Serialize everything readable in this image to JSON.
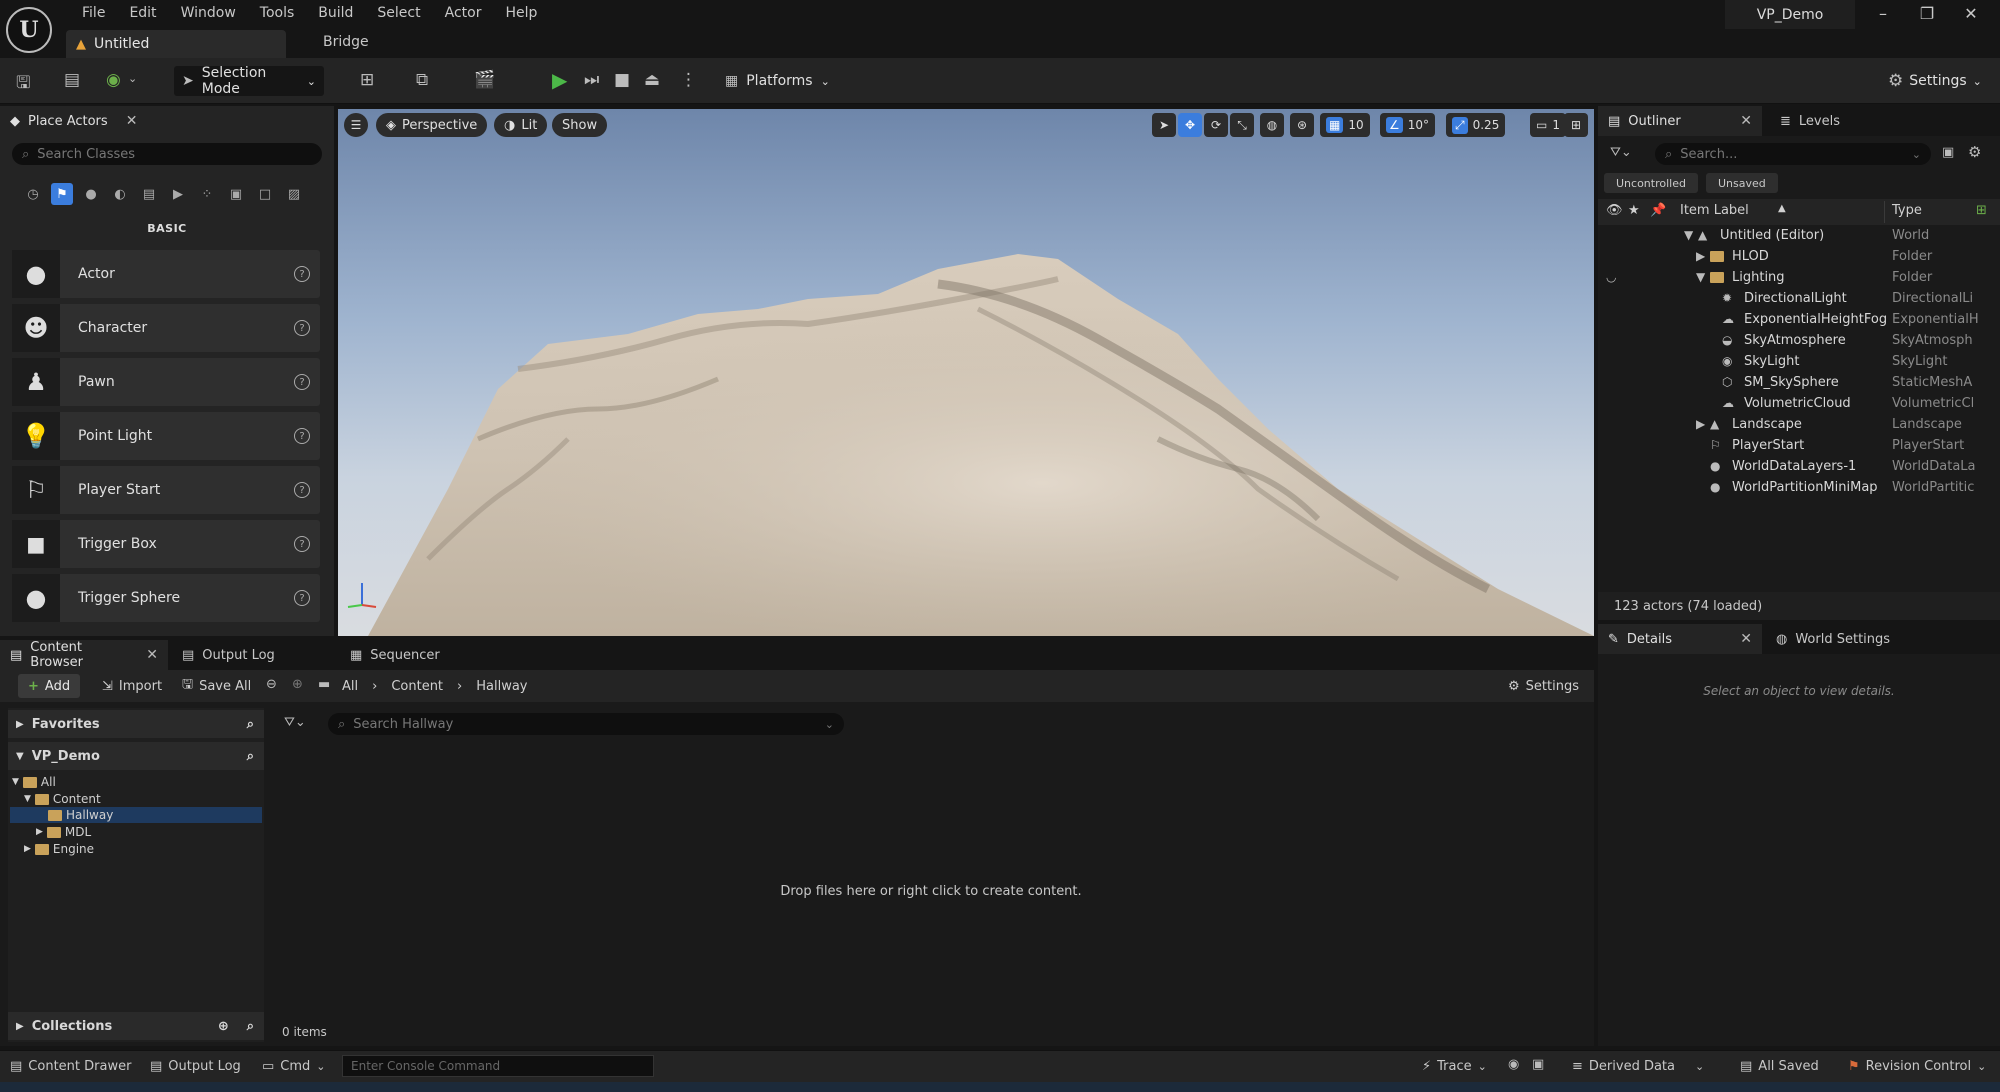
{
  "app": {
    "menu": [
      "File",
      "Edit",
      "Window",
      "Tools",
      "Build",
      "Select",
      "Actor",
      "Help"
    ],
    "doc_tab": "Untitled",
    "bridge_tab": "Bridge",
    "project": "VP_Demo"
  },
  "toolbar": {
    "selection_mode": "Selection Mode",
    "platforms": "Platforms",
    "settings": "Settings"
  },
  "place_actors": {
    "tab": "Place Actors",
    "search_placeholder": "Search Classes",
    "category": "BASIC",
    "items": [
      "Actor",
      "Character",
      "Pawn",
      "Point Light",
      "Player Start",
      "Trigger Box",
      "Trigger Sphere"
    ]
  },
  "viewport": {
    "perspective": "Perspective",
    "lit": "Lit",
    "show": "Show",
    "grid_snap": "10",
    "rot_snap": "10°",
    "scale_snap": "0.25",
    "camera_speed": "1"
  },
  "outliner": {
    "tab": "Outliner",
    "levels_tab": "Levels",
    "search_placeholder": "Search...",
    "filters": [
      "Uncontrolled",
      "Unsaved"
    ],
    "col_label": "Item Label",
    "col_type": "Type",
    "rows": [
      {
        "label": "Untitled (Editor)",
        "type": "World"
      },
      {
        "label": "HLOD",
        "type": "Folder"
      },
      {
        "label": "Lighting",
        "type": "Folder"
      },
      {
        "label": "DirectionalLight",
        "type": "DirectionalLi"
      },
      {
        "label": "ExponentialHeightFog",
        "type": "ExponentialH"
      },
      {
        "label": "SkyAtmosphere",
        "type": "SkyAtmosph"
      },
      {
        "label": "SkyLight",
        "type": "SkyLight"
      },
      {
        "label": "SM_SkySphere",
        "type": "StaticMeshA"
      },
      {
        "label": "VolumetricCloud",
        "type": "VolumetricCl"
      },
      {
        "label": "Landscape",
        "type": "Landscape"
      },
      {
        "label": "PlayerStart",
        "type": "PlayerStart"
      },
      {
        "label": "WorldDataLayers-1",
        "type": "WorldDataLa"
      },
      {
        "label": "WorldPartitionMiniMap",
        "type": "WorldPartitic"
      }
    ],
    "count": "123 actors (74 loaded)"
  },
  "details": {
    "tab": "Details",
    "world_tab": "World Settings",
    "empty_msg": "Select an object to view details."
  },
  "content_browser": {
    "tab": "Content Browser",
    "output_tab": "Output Log",
    "sequencer_tab": "Sequencer",
    "add": "Add",
    "import": "Import",
    "save_all": "Save All",
    "breadcrumb": [
      "All",
      "Content",
      "Hallway"
    ],
    "settings": "Settings",
    "favorites": "Favorites",
    "project": "VP_Demo",
    "tree": [
      "All",
      "Content",
      "Hallway",
      "MDL",
      "Engine"
    ],
    "collections": "Collections",
    "search_placeholder": "Search Hallway",
    "drop_msg": "Drop files here or right click to create content.",
    "items_count": "0 items"
  },
  "statusbar": {
    "content_drawer": "Content Drawer",
    "output_log": "Output Log",
    "cmd": "Cmd",
    "console_placeholder": "Enter Console Command",
    "trace": "Trace",
    "derived_data": "Derived Data",
    "all_saved": "All Saved",
    "revision_control": "Revision Control"
  }
}
